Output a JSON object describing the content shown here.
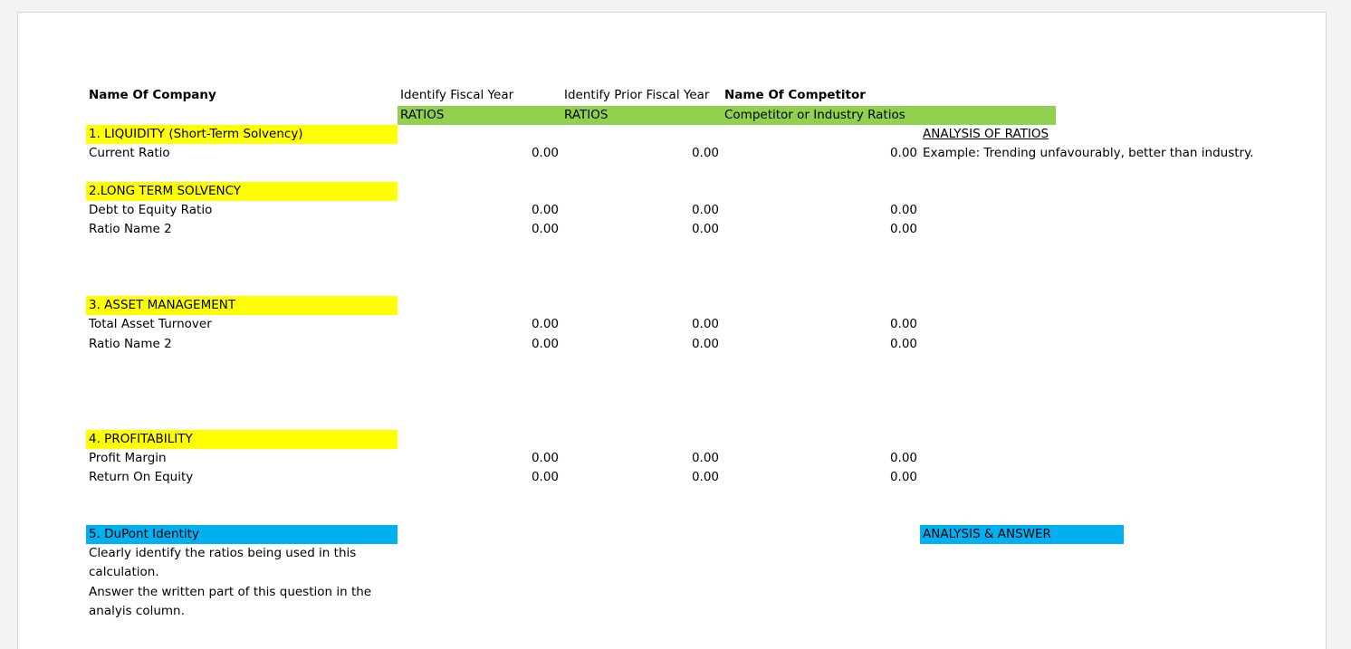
{
  "sheet": {
    "headers": {
      "company": "Name Of Company",
      "fiscal_year": "Identify Fiscal Year",
      "prior_year": "Identify Prior Fiscal Year",
      "competitor": "Name Of Competitor"
    },
    "subheaders": {
      "ratios": "RATIOS",
      "prior_ratios": "RATIOS",
      "competitor_ratios": "Competitor or Industry Ratios"
    },
    "sections": {
      "liquidity": "1. LIQUIDITY (Short-Term Solvency)",
      "long_term": "2.LONG TERM SOLVENCY",
      "asset_mgmt": "3. ASSET MANAGEMENT",
      "profitability": "4.  PROFITABILITY",
      "dupont": "5.  DuPont Identity"
    },
    "analysis_header": "ANALYSIS OF RATIOS",
    "analysis_example": "Example: Trending unfavourably, better than industry.",
    "analysis_answer": "ANALYSIS & ANSWER",
    "rows": [
      {
        "label": "Current Ratio",
        "fy": "0.00",
        "prior": "0.00",
        "comp": "0.00"
      },
      {
        "label": "Debt to Equity Ratio",
        "fy": "0.00",
        "prior": "0.00",
        "comp": "0.00"
      },
      {
        "label": "Ratio Name 2",
        "fy": "0.00",
        "prior": "0.00",
        "comp": "0.00"
      },
      {
        "label": "Total Asset Turnover",
        "fy": "0.00",
        "prior": "0.00",
        "comp": "0.00"
      },
      {
        "label": "Ratio Name 2",
        "fy": "0.00",
        "prior": "0.00",
        "comp": "0.00"
      },
      {
        "label": "Profit Margin",
        "fy": "0.00",
        "prior": "0.00",
        "comp": "0.00"
      },
      {
        "label": "Return On Equity",
        "fy": "0.00",
        "prior": "0.00",
        "comp": "0.00"
      }
    ],
    "dupont_notes": [
      "Clearly identify the ratios being used in this",
      "calculation.",
      "Answer the written part of this question in the",
      "analyis column."
    ],
    "colors": {
      "section": "#ffff00",
      "ratios_header": "#92d050",
      "dupont": "#00b0f0"
    }
  }
}
